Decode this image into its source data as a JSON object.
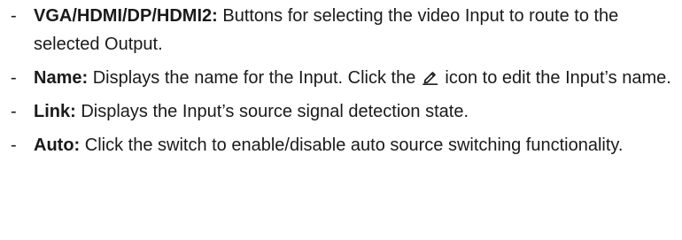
{
  "bullet_char": "-",
  "items": [
    {
      "term": "VGA/HDMI/DP/HDMI2:",
      "text": " Buttons for selecting the video Input to route to the selected Output."
    },
    {
      "term": "Name:",
      "text_before_icon": " Displays the name for the Input. Click the ",
      "icon": "pencil-edit-icon",
      "text_after_icon": " icon to edit the Input’s name."
    },
    {
      "term": "Link:",
      "text": " Displays the Input’s source signal detection state."
    },
    {
      "term": "Auto:",
      "text": " Click the switch to enable/disable auto source switching functionality."
    }
  ]
}
